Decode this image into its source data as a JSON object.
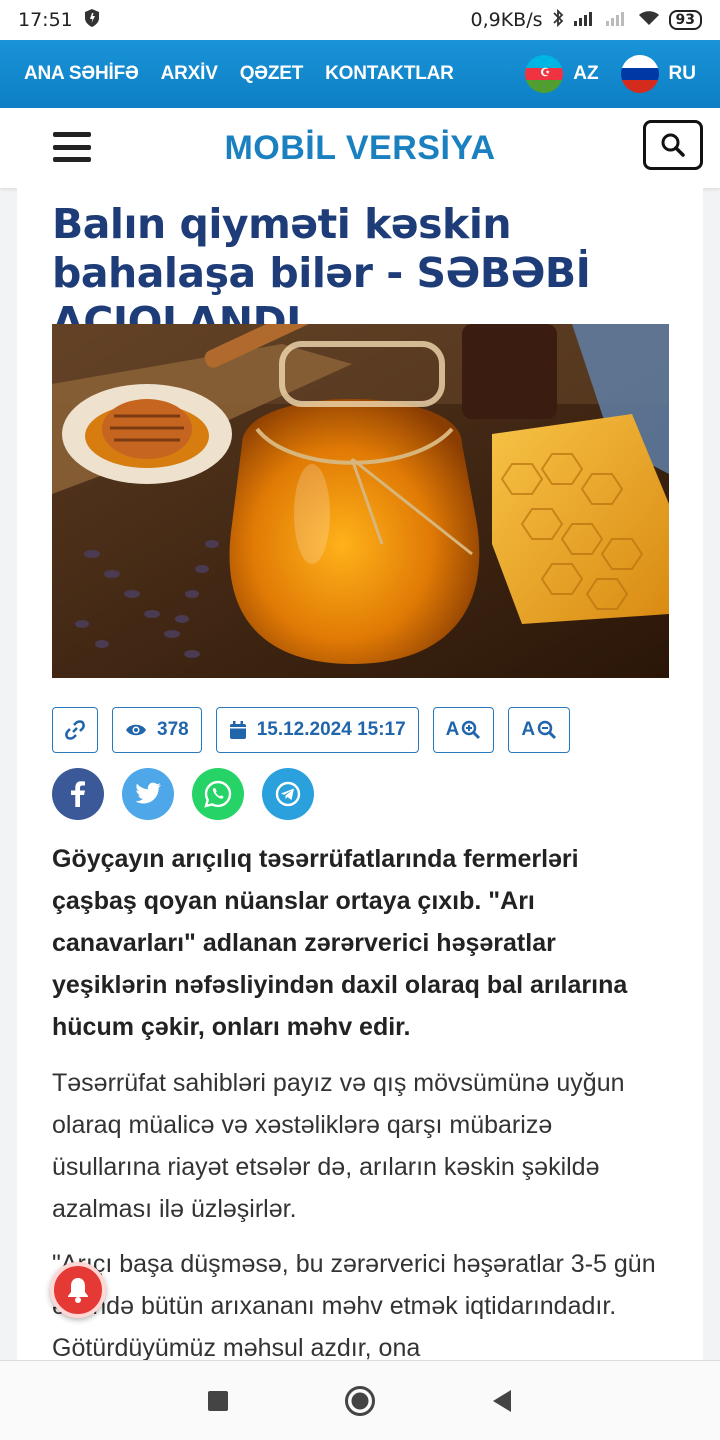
{
  "status_bar": {
    "time": "17:51",
    "network_speed": "0,9KB/s",
    "battery": "93",
    "icons": [
      "shield-icon",
      "bluetooth-icon",
      "signal-icon",
      "signal-weak-icon",
      "wifi-icon",
      "battery-icon"
    ]
  },
  "top_nav": {
    "links": [
      "ANA SƏHİFƏ",
      "ARXİV",
      "QƏZET",
      "KONTAKTLAR"
    ],
    "lang_az": "AZ",
    "lang_ru": "RU"
  },
  "header": {
    "title": "MOBİL VERSİYA",
    "icons": [
      "menu-icon",
      "search-icon"
    ]
  },
  "article": {
    "title": "Balın qiyməti kəskin bahalaşa bilər - SƏBƏBİ AÇIQLANDI",
    "views": "378",
    "date": "15.12.2024 15:17",
    "font_increase": "A",
    "font_decrease": "A",
    "lead": "Göyçayın arıçılıq təsərrüfatlarında fermerləri çaşbaş qoyan nüanslar ortaya çıxıb. \"Arı canavarları\" adlanan zərərverici həşəratlar yeşiklərin nəfəsliyindən daxil olaraq bal arılarına hücum çəkir, onları məhv edir.",
    "paragraph1": "Təsərrüfat sahibləri payız və qış mövsümünə uyğun olaraq müalicə və xəstəliklərə qarşı mübarizə üsullarına riayət etsələr də, arıların kəskin şəkildə azalması ilə üzləşirlər.",
    "paragraph2": "\"Arıçı başa düşməsə, bu zərərverici həşəratlar 3-5 gün ərzində bütün arıxananı məhv etmək iqtidarındadır. Götürdüyümüz məhsul azdır, ona"
  },
  "share": [
    "facebook-icon",
    "twitter-icon",
    "whatsapp-icon",
    "telegram-icon"
  ],
  "colors": {
    "brand_blue": "#1a80c0",
    "title_navy": "#1d3c78",
    "facebook": "#3b5998",
    "twitter": "#4da7e8",
    "whatsapp": "#25d366",
    "telegram": "#2aa0dc",
    "notification": "#e53935"
  }
}
